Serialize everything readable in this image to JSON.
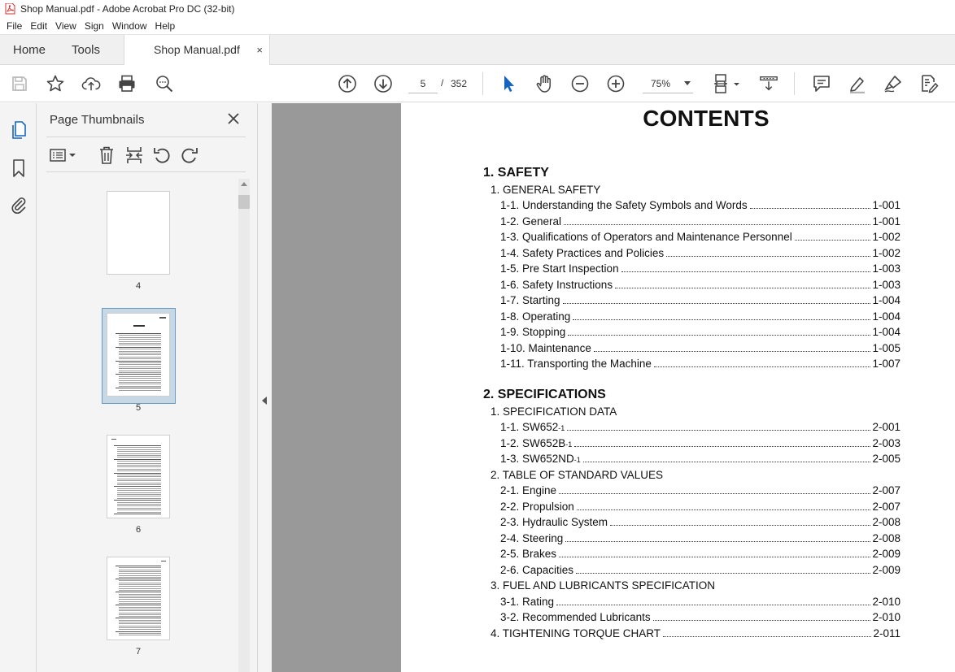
{
  "window": {
    "title": "Shop Manual.pdf - Adobe Acrobat Pro DC (32-bit)"
  },
  "menu": [
    "File",
    "Edit",
    "View",
    "Sign",
    "Window",
    "Help"
  ],
  "tabs": {
    "home": "Home",
    "tools": "Tools",
    "document": "Shop Manual.pdf",
    "close": "×"
  },
  "toolbar": {
    "current_page": "5",
    "page_separator": "/",
    "total_pages": "352",
    "zoom": "75%"
  },
  "thumbnails_panel": {
    "title": "Page Thumbnails",
    "pages": [
      {
        "label": "4"
      },
      {
        "label": "5",
        "selected": true
      },
      {
        "label": "6"
      },
      {
        "label": "7"
      }
    ]
  },
  "document": {
    "title": "CONTENTS",
    "sections": [
      {
        "title": "1. SAFETY",
        "groups": [
          {
            "title": "1. GENERAL SAFETY",
            "entries": [
              {
                "label": "1-1. Understanding the Safety Symbols and Words",
                "page": "1-001"
              },
              {
                "label": "1-2. General",
                "page": "1-001"
              },
              {
                "label": "1-3. Qualifications of Operators and Maintenance Personnel",
                "page": "1-002"
              },
              {
                "label": "1-4. Safety Practices and Policies",
                "page": "1-002"
              },
              {
                "label": "1-5. Pre Start Inspection",
                "page": "1-003"
              },
              {
                "label": "1-6. Safety Instructions",
                "page": "1-003"
              },
              {
                "label": "1-7. Starting",
                "page": "1-004"
              },
              {
                "label": "1-8. Operating",
                "page": "1-004"
              },
              {
                "label": "1-9. Stopping",
                "page": "1-004"
              },
              {
                "label": "1-10. Maintenance",
                "page": "1-005"
              },
              {
                "label": "1-11. Transporting the Machine",
                "page": "1-007"
              }
            ]
          }
        ]
      },
      {
        "title": "2. SPECIFICATIONS",
        "groups": [
          {
            "title": "1. SPECIFICATION DATA",
            "entries": [
              {
                "label": "1-1. SW652",
                "suffix": "-1",
                "page": "2-001"
              },
              {
                "label": "1-2. SW652B",
                "suffix": "-1",
                "page": "2-003"
              },
              {
                "label": "1-3. SW652ND",
                "suffix": "-1",
                "page": "2-005"
              }
            ]
          },
          {
            "title": "2. TABLE OF STANDARD VALUES",
            "entries": [
              {
                "label": "2-1. Engine",
                "page": "2-007"
              },
              {
                "label": "2-2. Propulsion",
                "page": "2-007"
              },
              {
                "label": "2-3. Hydraulic System",
                "page": "2-008"
              },
              {
                "label": "2-4. Steering",
                "page": "2-008"
              },
              {
                "label": "2-5. Brakes",
                "page": "2-009"
              },
              {
                "label": "2-6. Capacities",
                "page": "2-009"
              }
            ]
          },
          {
            "title": "3. FUEL AND LUBRICANTS SPECIFICATION",
            "entries": [
              {
                "label": "3-1. Rating",
                "page": "2-010"
              },
              {
                "label": "3-2. Recommended Lubricants",
                "page": "2-010"
              }
            ]
          }
        ],
        "tail": {
          "label": "4. TIGHTENING TORQUE CHART",
          "page": "2-011"
        }
      }
    ]
  },
  "colors": {
    "acrobat_red": "#d32f2f",
    "selection_blue": "#6a9ac2",
    "select_tool_blue": "#1565c0"
  }
}
